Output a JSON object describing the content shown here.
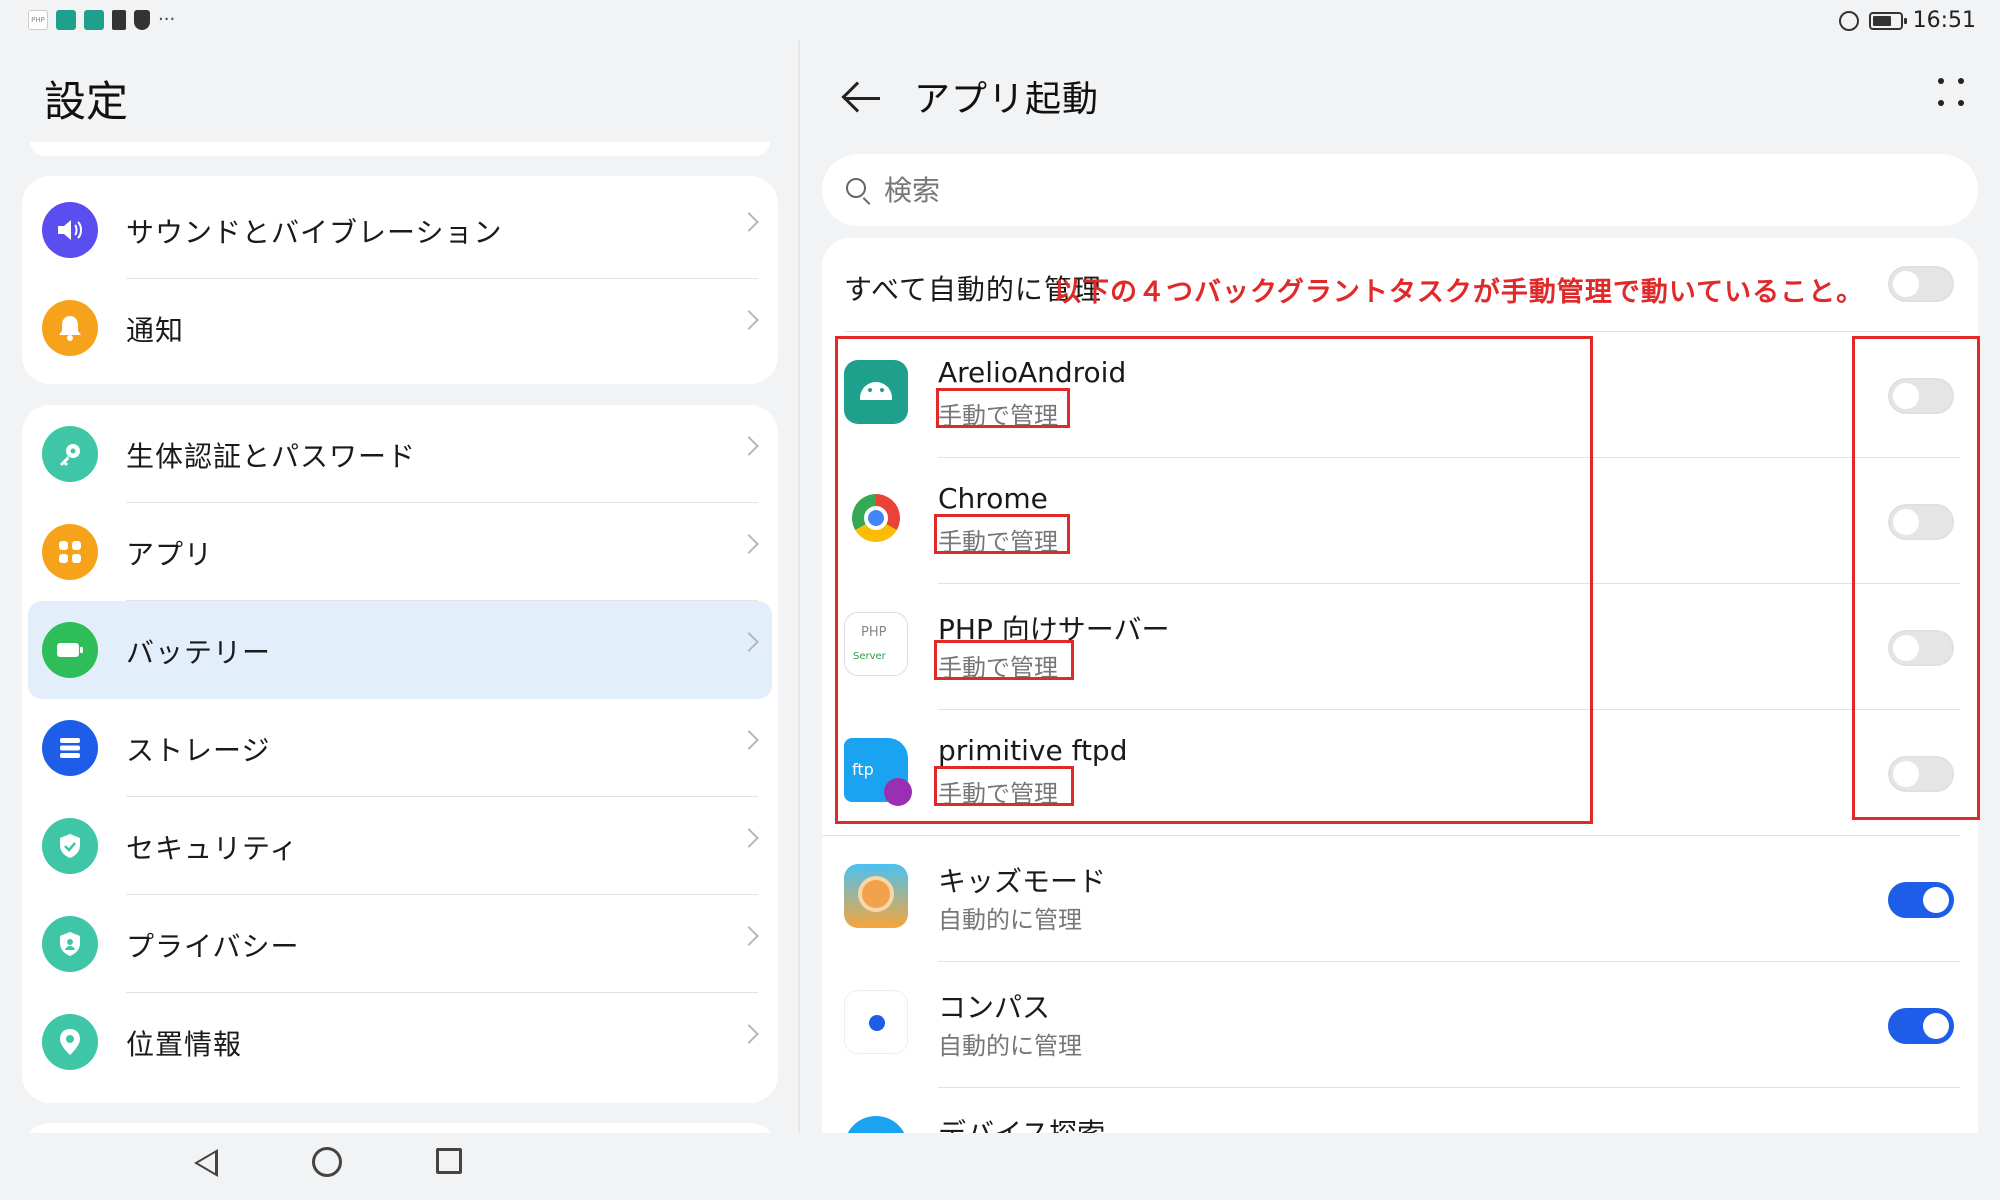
{
  "status_bar": {
    "time": "16:51",
    "left_icons": [
      "php-server-icon",
      "android-icon",
      "android-icon",
      "document-icon",
      "shield-icon",
      "more-icon"
    ],
    "left_php_label": "PHP",
    "more_dots": "···"
  },
  "settings": {
    "title": "設定",
    "group1": [
      {
        "label": "サウンドとバイブレーション",
        "icon": "speaker-icon",
        "color": "#5b4ef0"
      },
      {
        "label": "通知",
        "icon": "bell-icon",
        "color": "#f7a21b"
      }
    ],
    "group2": [
      {
        "label": "生体認証とパスワード",
        "icon": "key-icon",
        "color": "#3fc6a6"
      },
      {
        "label": "アプリ",
        "icon": "apps-icon",
        "color": "#f7a21b"
      },
      {
        "label": "バッテリー",
        "icon": "battery-icon",
        "color": "#2fbd59",
        "selected": true
      },
      {
        "label": "ストレージ",
        "icon": "storage-icon",
        "color": "#1d5de8"
      },
      {
        "label": "セキュリティ",
        "icon": "security-icon",
        "color": "#3fc6a6"
      },
      {
        "label": "プライバシー",
        "icon": "privacy-icon",
        "color": "#3fc6a6"
      },
      {
        "label": "位置情報",
        "icon": "location-icon",
        "color": "#3fc6a6"
      }
    ]
  },
  "app_launch": {
    "title": "アプリ起動",
    "search_placeholder": "検索",
    "all_auto_label": "すべて自動的に管理",
    "all_auto_on": false,
    "annotation": "以下の４つバックグラントタスクが手動管理で動いていること。",
    "apps": [
      {
        "name": "ArelioAndroid",
        "status": "手動で管理",
        "on": false,
        "icon": "android-app-icon"
      },
      {
        "name": "Chrome",
        "status": "手動で管理",
        "on": false,
        "icon": "chrome-icon"
      },
      {
        "name": "PHP 向けサーバー",
        "status": "手動で管理",
        "on": false,
        "icon": "php-server-icon",
        "icon_text": [
          "PHP",
          "Server"
        ]
      },
      {
        "name": "primitive ftpd",
        "status": "手動で管理",
        "on": false,
        "icon": "ftp-icon",
        "icon_text": [
          "ftp"
        ]
      },
      {
        "name": "キッズモード",
        "status": "自動的に管理",
        "on": true,
        "icon": "kids-mode-icon"
      },
      {
        "name": "コンパス",
        "status": "自動的に管理",
        "on": true,
        "icon": "compass-icon"
      },
      {
        "name": "デバイス探索",
        "status": "",
        "on": true,
        "icon": "device-search-icon"
      }
    ]
  },
  "colors": {
    "accent": "#1d5de8",
    "annotation_red": "#e02a2a",
    "selected_bg": "#e3eefb"
  }
}
